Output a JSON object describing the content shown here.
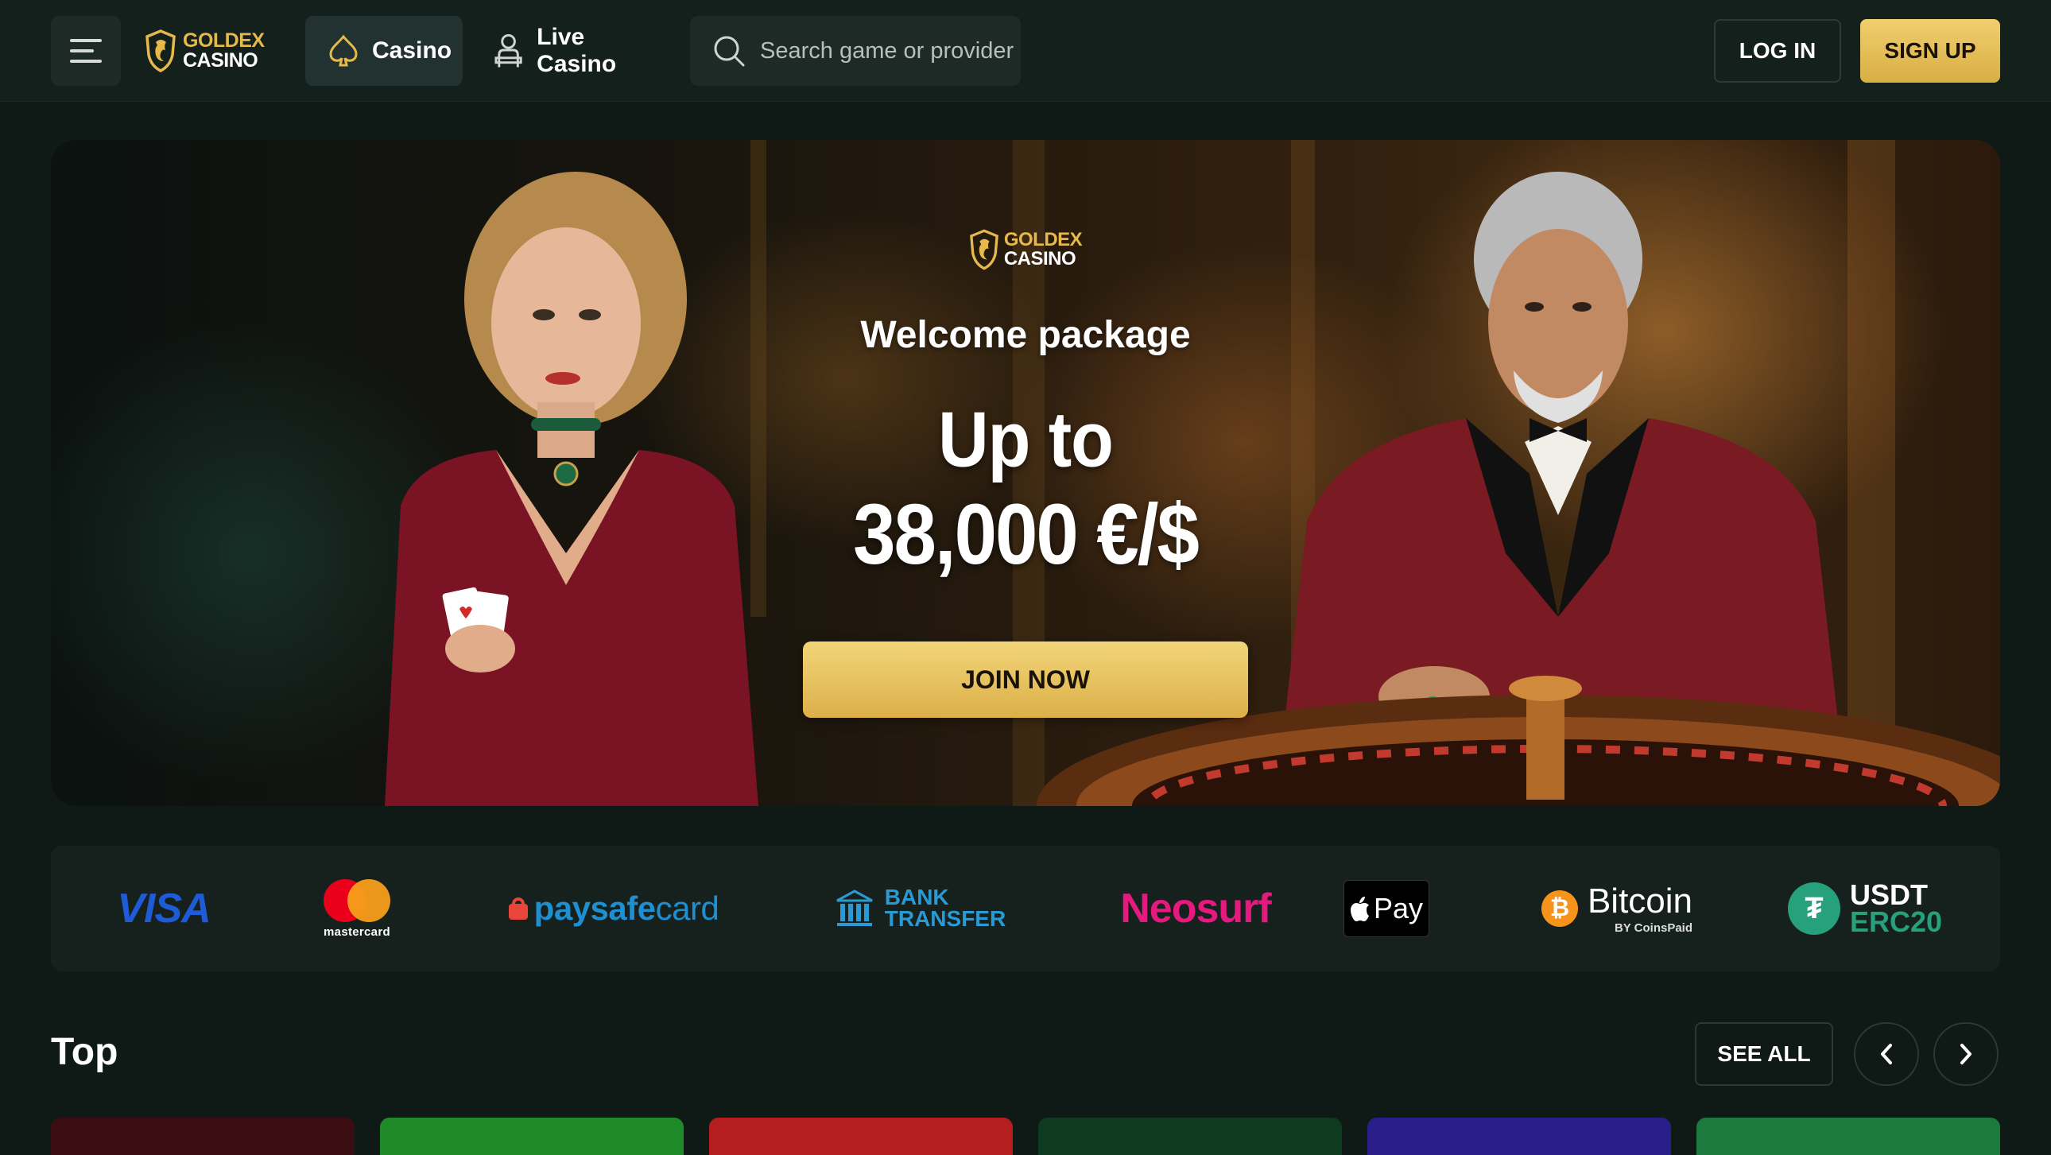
{
  "header": {
    "brand_line1": "GOLDEX",
    "brand_line2": "CASINO",
    "nav": {
      "casino": "Casino",
      "live_casino": "Live Casino"
    },
    "search_placeholder": "Search game or provider",
    "login": "LOG IN",
    "signup": "SIGN UP"
  },
  "hero": {
    "brand_line1": "GOLDEX",
    "brand_line2": "CASINO",
    "subtitle": "Welcome package",
    "headline_line1": "Up to",
    "headline_line2": "38,000 €/$",
    "cta": "JOIN NOW"
  },
  "payments": {
    "visa": "VISA",
    "mastercard": "mastercard",
    "paysafe_a": "paysafe",
    "paysafe_b": "card",
    "bank_line1": "BANK",
    "bank_line2": "TRANSFER",
    "neosurf": "Neosurf",
    "applepay": "Pay",
    "bitcoin": "Bitcoin",
    "bitcoin_sub": "BY CoinsPaid",
    "usdt_line1": "USDT",
    "usdt_line2": "ERC20"
  },
  "top_section": {
    "title": "Top",
    "see_all": "SEE ALL",
    "prev": "‹",
    "next": "›"
  },
  "colors": {
    "background": "#0f1a17",
    "header": "#14201c",
    "gold": "#e6b94a",
    "button_gold": "#dcb04a"
  },
  "game_tiles": [
    {
      "color": "#3a0d12"
    },
    {
      "color": "#1f8a28"
    },
    {
      "color": "#b41e1e"
    },
    {
      "color": "#0e3a20"
    },
    {
      "color": "#2a1f8a"
    },
    {
      "color": "#1c7a3e"
    }
  ]
}
